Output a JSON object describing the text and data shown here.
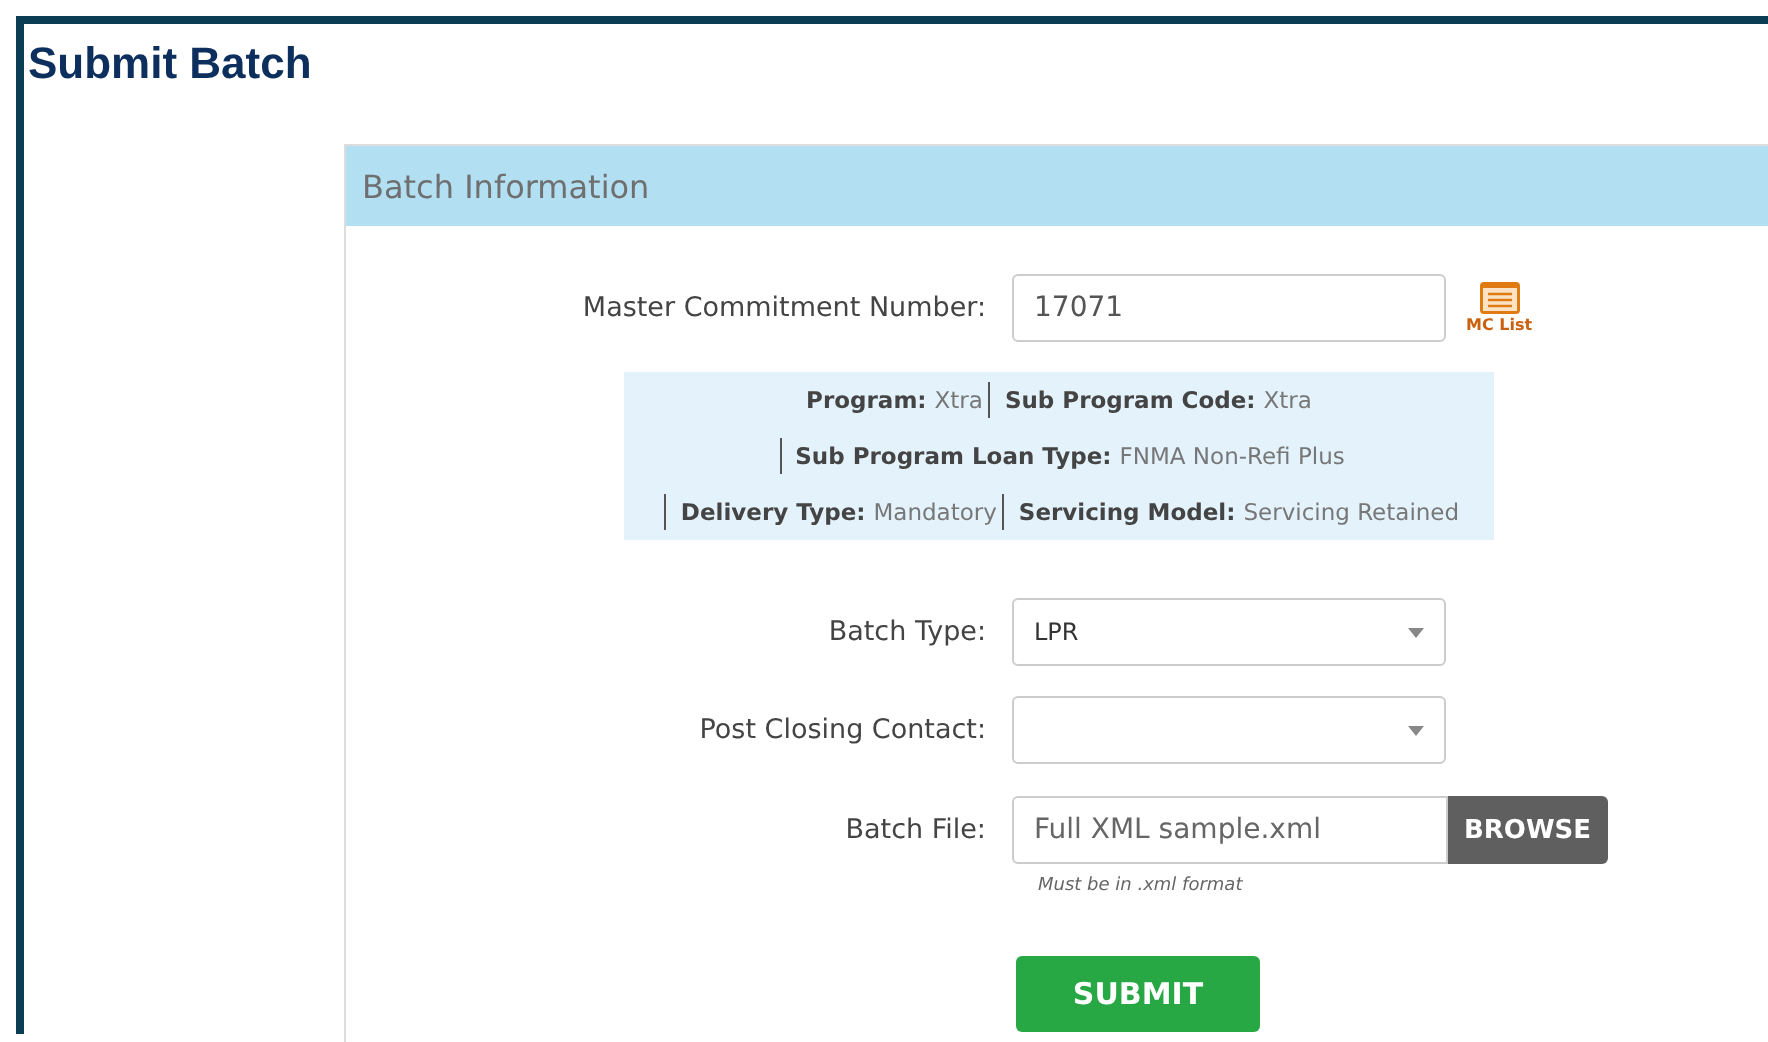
{
  "page": {
    "title": "Submit Batch"
  },
  "panel": {
    "title": "Batch Information"
  },
  "commitment": {
    "label": "Master Commitment Number:",
    "value": "17071",
    "link": "MC List"
  },
  "info_lines": [
    {
      "items": [
        {
          "label": "Program:",
          "value": "Xtra",
          "divider": false
        },
        {
          "label": "Sub Program Code:",
          "value": "Xtra",
          "divider": true
        }
      ]
    },
    {
      "items": [
        {
          "label": "Sub Program Loan Type:",
          "value": "FNMA Non-Refi Plus",
          "divider": true
        }
      ]
    },
    {
      "items": [
        {
          "label": "Delivery Type:",
          "value": "Mandatory",
          "divider": true
        },
        {
          "label": "Servicing Model:",
          "value": "Servicing Retained",
          "divider": true
        }
      ]
    }
  ],
  "fields": [
    {
      "kind": "select",
      "label": "Batch Type:",
      "value": "LPR"
    },
    {
      "kind": "select",
      "label": "Post Closing Contact:"
    },
    {
      "kind": "file",
      "label": "Batch File:",
      "value": "Full XML sample.xml",
      "button": "BROWSE",
      "hint": "Must be in .xml format"
    }
  ],
  "submit": "SUBMIT"
}
